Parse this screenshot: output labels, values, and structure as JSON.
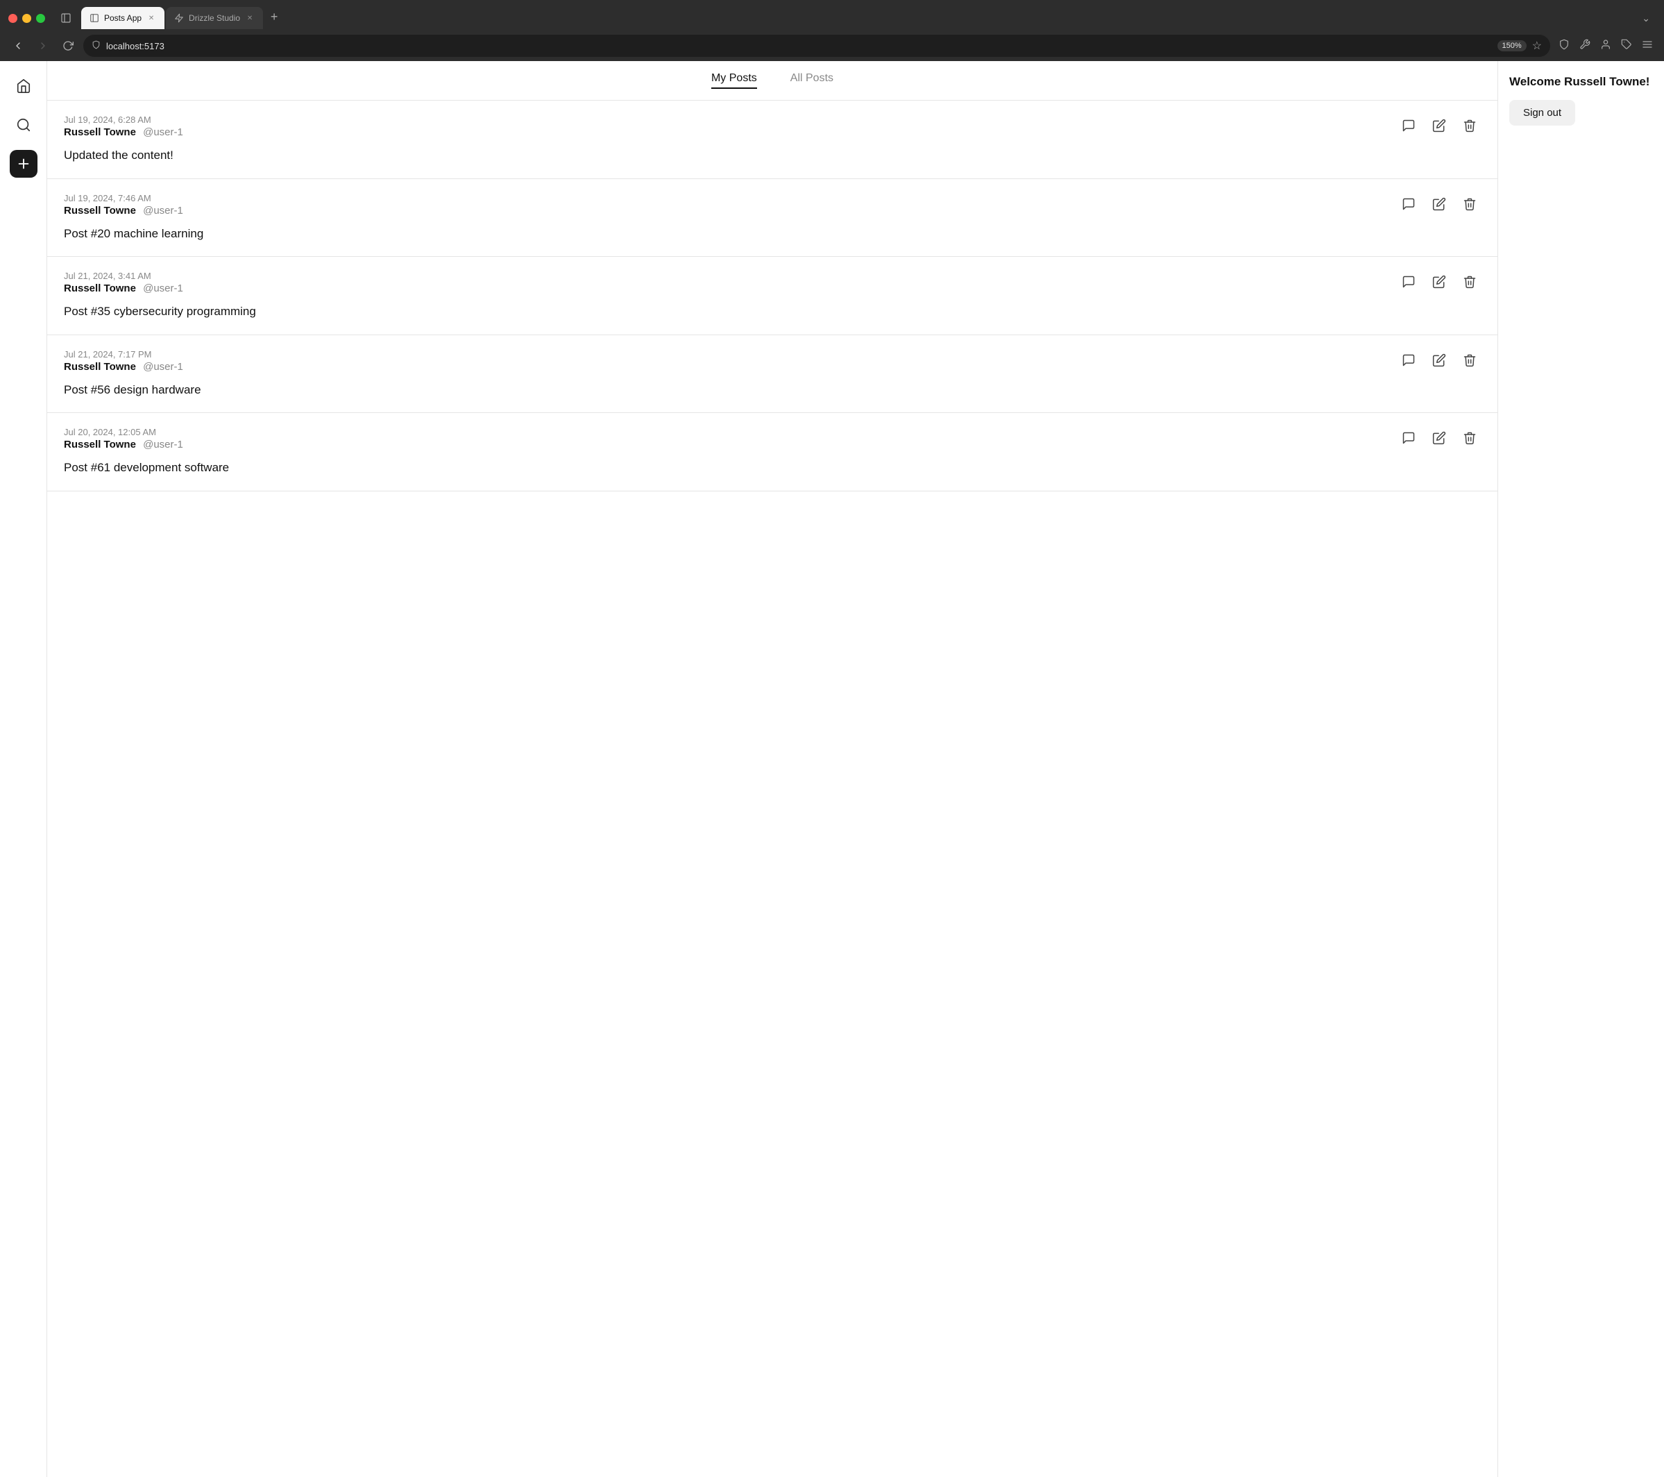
{
  "browser": {
    "tabs": [
      {
        "id": "posts-app",
        "label": "Posts App",
        "active": true,
        "url": "localhost:5173"
      },
      {
        "id": "drizzle-studio",
        "label": "Drizzle Studio",
        "active": false
      }
    ],
    "url": "localhost:5173",
    "zoom": "150%",
    "back_disabled": false,
    "forward_disabled": true
  },
  "sidebar": {
    "home_label": "Home",
    "search_label": "Search",
    "new_post_label": "New Post"
  },
  "tabs": {
    "my_posts": "My Posts",
    "all_posts": "All Posts",
    "active": "my_posts"
  },
  "right_panel": {
    "welcome": "Welcome Russell Towne!",
    "sign_out": "Sign out"
  },
  "posts": [
    {
      "id": 1,
      "timestamp": "Jul 19, 2024, 6:28 AM",
      "author": "Russell Towne",
      "handle": "@user-1",
      "content": "Updated the content!"
    },
    {
      "id": 2,
      "timestamp": "Jul 19, 2024, 7:46 AM",
      "author": "Russell Towne",
      "handle": "@user-1",
      "content": "Post #20 machine learning"
    },
    {
      "id": 3,
      "timestamp": "Jul 21, 2024, 3:41 AM",
      "author": "Russell Towne",
      "handle": "@user-1",
      "content": "Post #35 cybersecurity programming"
    },
    {
      "id": 4,
      "timestamp": "Jul 21, 2024, 7:17 PM",
      "author": "Russell Towne",
      "handle": "@user-1",
      "content": "Post #56 design hardware"
    },
    {
      "id": 5,
      "timestamp": "Jul 20, 2024, 12:05 AM",
      "author": "Russell Towne",
      "handle": "@user-1",
      "content": "Post #61 development software"
    }
  ]
}
